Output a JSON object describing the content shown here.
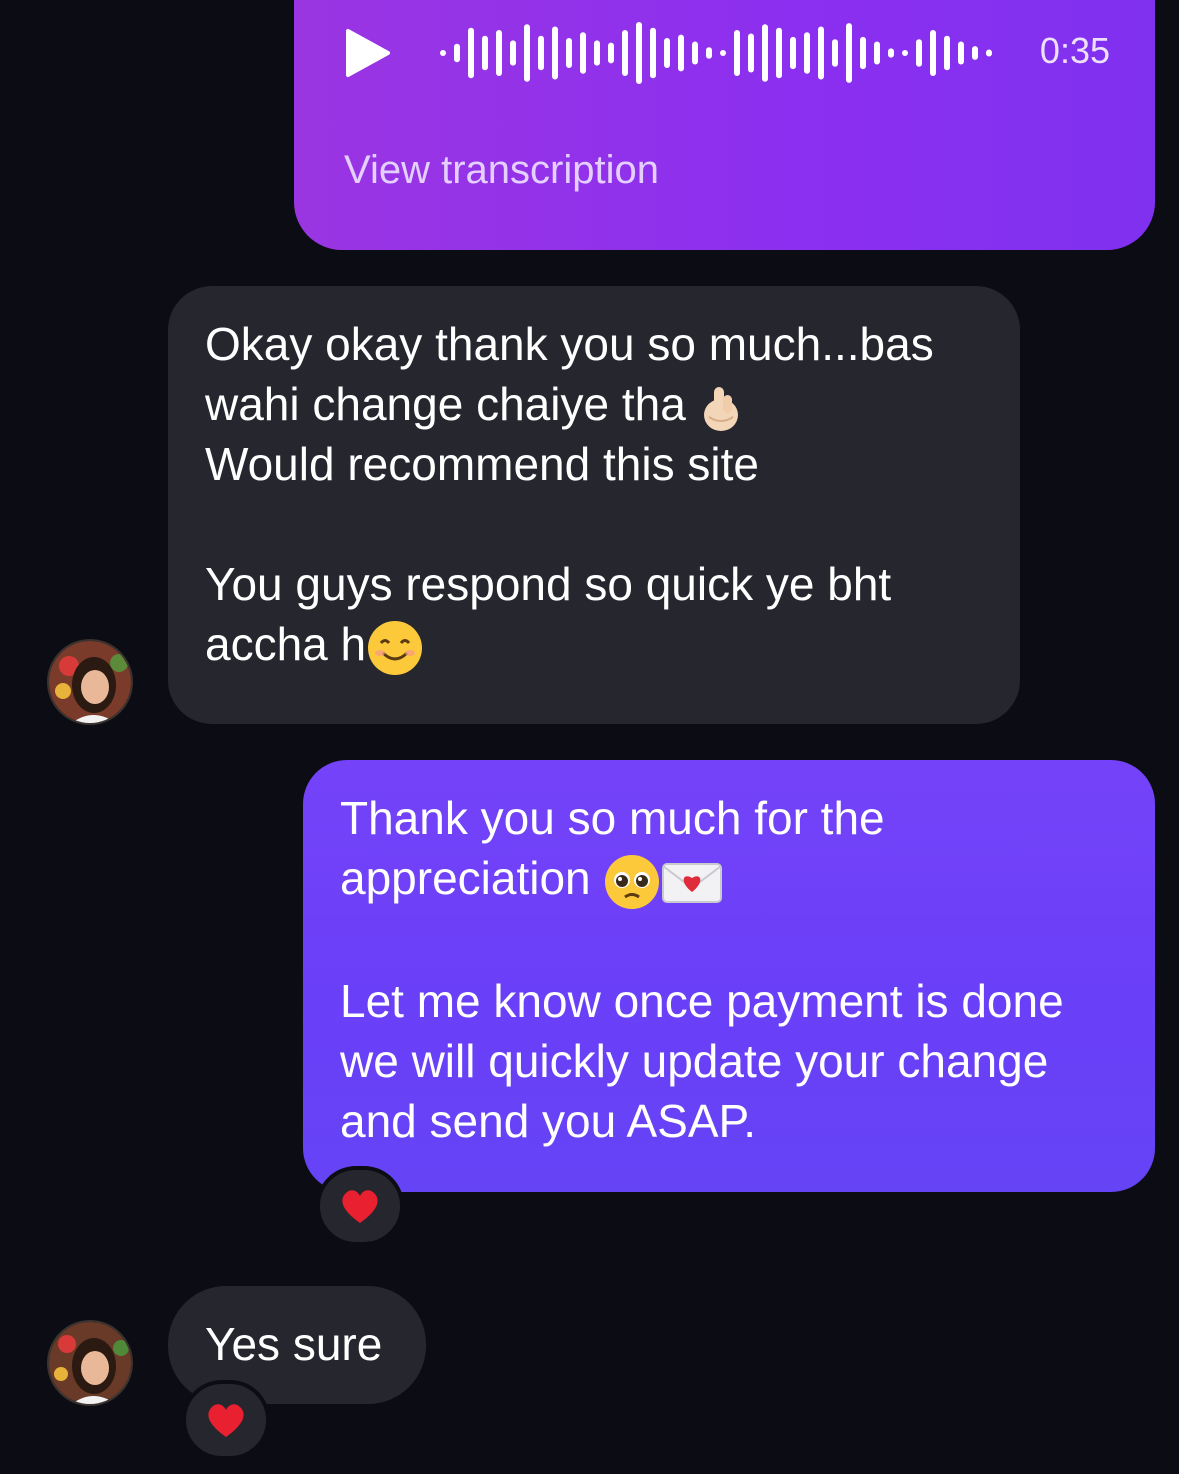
{
  "voice_message": {
    "duration": "0:35",
    "transcription_link": "View transcription",
    "play_icon": "play-icon",
    "waveform_icon": "audio-waveform"
  },
  "messages": [
    {
      "direction": "incoming",
      "line1": "Okay okay thank you so much...bas",
      "line2": "wahi change chaiye tha",
      "line2_emoji": "pinching-hand-emoji",
      "line3": "Would recommend this site",
      "line4": "You guys respond so quick ye bht",
      "line5": "accha h",
      "line5_emoji": "smiling-face-emoji"
    },
    {
      "direction": "outgoing",
      "line1": "Thank you so much for the",
      "line2": "appreciation",
      "line2_emojis": [
        "pleading-face-emoji",
        "love-letter-emoji"
      ],
      "line3": "Let me know once payment is done",
      "line4": "we will quickly update your change",
      "line5": "and send you ASAP.",
      "reaction": "red-heart-emoji"
    },
    {
      "direction": "incoming",
      "text": "Yes sure",
      "reaction": "red-heart-emoji"
    }
  ],
  "colors": {
    "background": "#0c0d14",
    "incoming_bubble": "#25262e",
    "outgoing_bubble": "#6c40f8",
    "voice_bubble": "#8f32ea"
  }
}
